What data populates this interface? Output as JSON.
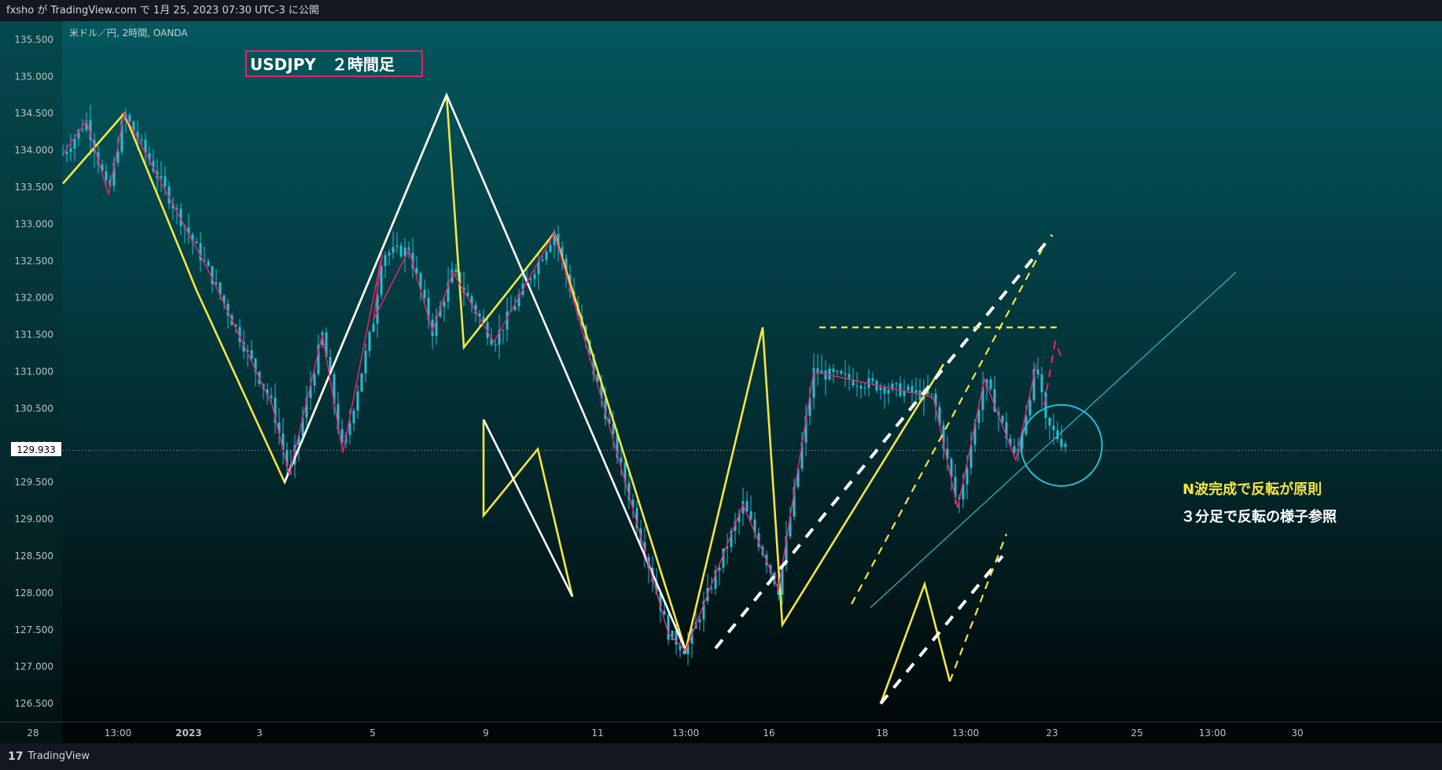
{
  "header": {
    "published_text": "fxsho が TradingView.com で 1月 25, 2023 07:30 UTC-3 に公開"
  },
  "footer": {
    "brand_label": "TradingView",
    "brand_logo": "17"
  },
  "chart_data": {
    "type": "candlestick",
    "symbol_label": "米ドル／円, 2時間, OANDA",
    "title": "USDJPY　２時間足",
    "y_ticks": [
      "135.500",
      "135.000",
      "134.500",
      "134.000",
      "133.500",
      "133.000",
      "132.500",
      "132.000",
      "131.500",
      "131.000",
      "130.500",
      "130.000",
      "129.500",
      "129.000",
      "128.500",
      "128.000",
      "127.500",
      "127.000",
      "126.500"
    ],
    "ylim": [
      126.25,
      135.75
    ],
    "x_ticks": [
      "28",
      "13:00",
      "2023",
      "3",
      "5",
      "9",
      "11",
      "13:00",
      "16",
      "18",
      "13:00",
      "23",
      "25",
      "13:00",
      "30"
    ],
    "current_price": "129.933",
    "annotations": [
      {
        "text": "N波完成で反転が原則",
        "color": "#f5e642"
      },
      {
        "text": "３分足で反転の様子参照",
        "color": "#ffffff"
      }
    ],
    "series": [
      {
        "name": "",
        "color": "#f5e642",
        "points": [
          [
            0,
            133.55
          ],
          [
            78,
            134.5
          ],
          [
            170,
            132.1
          ],
          [
            282,
            129.5
          ],
          [
            488,
            134.75
          ],
          [
            510,
            131.33
          ],
          [
            625,
            132.88
          ],
          [
            792,
            127.22
          ],
          [
            890,
            131.6
          ],
          [
            915,
            127.57
          ],
          [
            1120,
            131.1
          ]
        ]
      },
      {
        "name": "",
        "color": "#ffffff",
        "points": [
          [
            282,
            129.5
          ],
          [
            488,
            134.75
          ],
          [
            792,
            127.22
          ]
        ]
      },
      {
        "name": "",
        "color": "#e0246a",
        "points": [
          [
            0,
            133.95
          ],
          [
            30,
            134.4
          ],
          [
            58,
            133.4
          ],
          [
            78,
            134.5
          ],
          [
            186,
            132.35
          ],
          [
            266,
            130.55
          ],
          [
            288,
            129.6
          ],
          [
            330,
            131.5
          ],
          [
            356,
            129.9
          ],
          [
            406,
            132.6
          ],
          [
            395,
            131.7
          ],
          [
            440,
            132.65
          ],
          [
            470,
            131.55
          ],
          [
            496,
            132.35
          ],
          [
            548,
            131.4
          ],
          [
            625,
            132.88
          ],
          [
            770,
            127.45
          ],
          [
            792,
            127.22
          ],
          [
            865,
            129.2
          ],
          [
            910,
            128.05
          ],
          [
            955,
            131.0
          ],
          [
            1107,
            130.65
          ],
          [
            1138,
            129.15
          ],
          [
            1172,
            130.9
          ],
          [
            1212,
            129.8
          ],
          [
            1238,
            131.1
          ]
        ]
      },
      {
        "name": "",
        "color": "#f5e642",
        "points": [
          [
            535,
            130.35
          ],
          [
            535,
            129.05
          ],
          [
            604,
            129.95
          ],
          [
            648,
            127.95
          ]
        ]
      },
      {
        "name": "",
        "color": "#ffffff",
        "points": [
          [
            535,
            130.35
          ],
          [
            648,
            127.95
          ]
        ]
      },
      {
        "name": "",
        "color": "#f5e642",
        "points": [
          [
            1040,
            126.5
          ],
          [
            1096,
            128.12
          ],
          [
            1128,
            126.8
          ]
        ]
      }
    ],
    "dashed_lines": [
      {
        "color": "#ffffff",
        "points": [
          [
            830,
            127.25
          ],
          [
            1258,
            132.85
          ]
        ]
      },
      {
        "color": "#ffffff",
        "points": [
          [
            1040,
            126.5
          ],
          [
            1195,
            128.5
          ]
        ]
      },
      {
        "color": "#f5e642",
        "points": [
          [
            1003,
            127.85
          ],
          [
            1245,
            132.65
          ]
        ]
      },
      {
        "color": "#f5e642",
        "points": [
          [
            1128,
            126.8
          ],
          [
            1200,
            128.8
          ]
        ]
      },
      {
        "color": "#f5e642",
        "points": [
          [
            962,
            131.6
          ],
          [
            1265,
            131.6
          ]
        ]
      },
      {
        "color": "#e0246a",
        "points": [
          [
            1248,
            130.55
          ],
          [
            1262,
            131.4
          ],
          [
            1272,
            131.15
          ]
        ]
      }
    ],
    "trend_line": {
      "color": "#2bbcd4",
      "points": [
        [
          1027,
          127.8
        ],
        [
          1492,
          132.35
        ]
      ]
    },
    "circle": {
      "color": "#2bbcd4",
      "center": [
        1270,
        130.0
      ],
      "radius_price": 0.55
    },
    "candles_seed": 7
  }
}
